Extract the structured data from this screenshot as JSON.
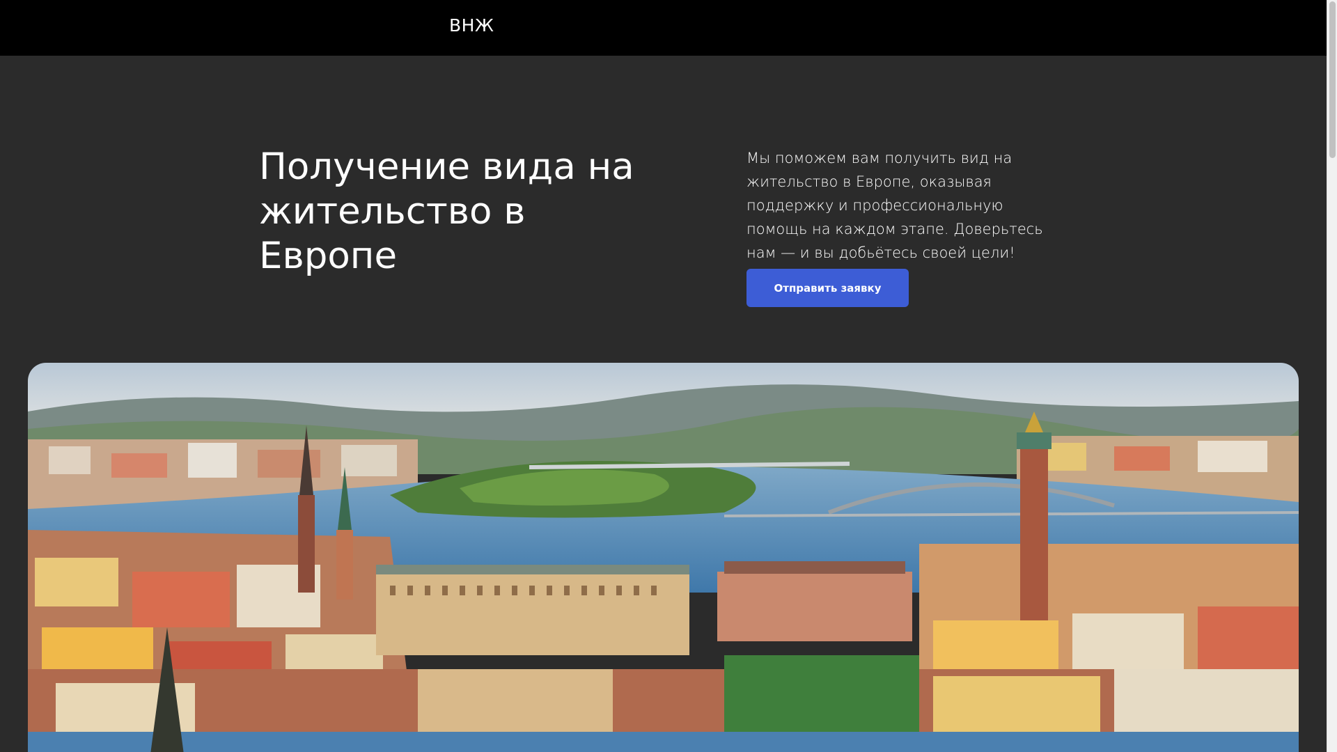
{
  "header": {
    "logo": "ВНЖ"
  },
  "hero": {
    "title": "Получение вида на жительство в Европе",
    "description": "Мы поможем вам получить вид на жительство в Европе, оказывая поддержку и профессиональную помощь на каждом этапе. Доверьтесь нам — и вы добьётесь своей цели!",
    "cta_label": "Отправить заявку"
  },
  "image": {
    "description": "aerial-city-panorama"
  },
  "colors": {
    "background": "#2b2b2b",
    "header": "#000000",
    "accent": "#3d5dd6"
  }
}
